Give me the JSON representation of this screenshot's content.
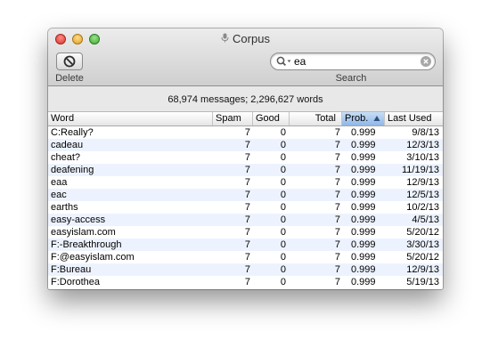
{
  "window": {
    "title": "Corpus"
  },
  "toolbar": {
    "delete_label": "Delete",
    "search_label": "Search"
  },
  "search": {
    "value": "ea"
  },
  "stats": "68,974 messages; 2,296,627 words",
  "table": {
    "columns": [
      "Word",
      "Spam",
      "Good",
      "Total",
      "Prob.",
      "Last Used"
    ],
    "sorted_column": "Prob.",
    "sort_direction": "ascending",
    "rows": [
      [
        "C:Really?",
        "7",
        "0",
        "7",
        "0.999",
        "9/8/13"
      ],
      [
        "cadeau",
        "7",
        "0",
        "7",
        "0.999",
        "12/3/13"
      ],
      [
        "cheat?",
        "7",
        "0",
        "7",
        "0.999",
        "3/10/13"
      ],
      [
        "deafening",
        "7",
        "0",
        "7",
        "0.999",
        "11/19/13"
      ],
      [
        "eaa",
        "7",
        "0",
        "7",
        "0.999",
        "12/9/13"
      ],
      [
        "eac",
        "7",
        "0",
        "7",
        "0.999",
        "12/5/13"
      ],
      [
        "earths",
        "7",
        "0",
        "7",
        "0.999",
        "10/2/13"
      ],
      [
        "easy-access",
        "7",
        "0",
        "7",
        "0.999",
        "4/5/13"
      ],
      [
        "easyislam.com",
        "7",
        "0",
        "7",
        "0.999",
        "5/20/12"
      ],
      [
        "F:-Breakthrough",
        "7",
        "0",
        "7",
        "0.999",
        "3/30/13"
      ],
      [
        "F:@easyislam.com",
        "7",
        "0",
        "7",
        "0.999",
        "5/20/12"
      ],
      [
        "F:Bureau",
        "7",
        "0",
        "7",
        "0.999",
        "12/9/13"
      ],
      [
        "F:Dorothea",
        "7",
        "0",
        "7",
        "0.999",
        "5/19/13"
      ]
    ]
  },
  "icons": {
    "title": "microphone-icon",
    "delete": "no-entry-icon",
    "search": "magnifier-dropdown-icon",
    "clear": "clear-circle-icon",
    "sort": "triangle-up-icon"
  },
  "colors": {
    "close": "#e0443c",
    "minimize": "#e7a928",
    "zoom": "#4cbb3a",
    "sorted_header": "#a9c9ef",
    "alt_row": "#edf3fe"
  }
}
